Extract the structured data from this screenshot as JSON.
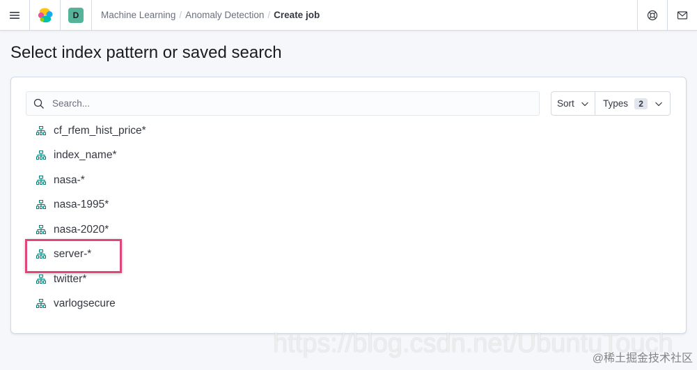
{
  "header": {
    "menu_icon": "hamburger-menu-icon",
    "logo_icon": "elastic-logo-icon",
    "avatar_initial": "D",
    "breadcrumbs": [
      {
        "label": "Machine Learning"
      },
      {
        "label": "Anomaly Detection"
      },
      {
        "label": "Create job"
      }
    ],
    "breadcrumb_separator": "/",
    "help_icon": "lifebuoy-help-icon",
    "newsfeed_icon": "mail-icon"
  },
  "page": {
    "title": "Select index pattern or saved search"
  },
  "panel": {
    "search": {
      "placeholder": "Search...",
      "value": "",
      "icon": "search-icon"
    },
    "sort": {
      "label": "Sort",
      "icon": "chevron-down-icon"
    },
    "types": {
      "label": "Types",
      "count": "2",
      "icon": "chevron-down-icon"
    },
    "item_icon": "index-pattern-icon",
    "items": [
      {
        "label": "cf_rfem_hist_price*",
        "highlighted": false
      },
      {
        "label": "index_name*",
        "highlighted": false
      },
      {
        "label": "nasa-*",
        "highlighted": false
      },
      {
        "label": "nasa-1995*",
        "highlighted": false
      },
      {
        "label": "nasa-2020*",
        "highlighted": false
      },
      {
        "label": "server-*",
        "highlighted": true
      },
      {
        "label": "twitter*",
        "highlighted": false
      },
      {
        "label": "varlogsecure",
        "highlighted": false
      }
    ]
  },
  "watermark": {
    "url": "https://blog.csdn.net/UbuntuTouch",
    "credit": "@稀土掘金技术社区"
  },
  "colors": {
    "avatar": "#54B399",
    "highlight_box": "#E0457B",
    "index_icon": "#017D73",
    "page_background": "#F5F7FA"
  }
}
